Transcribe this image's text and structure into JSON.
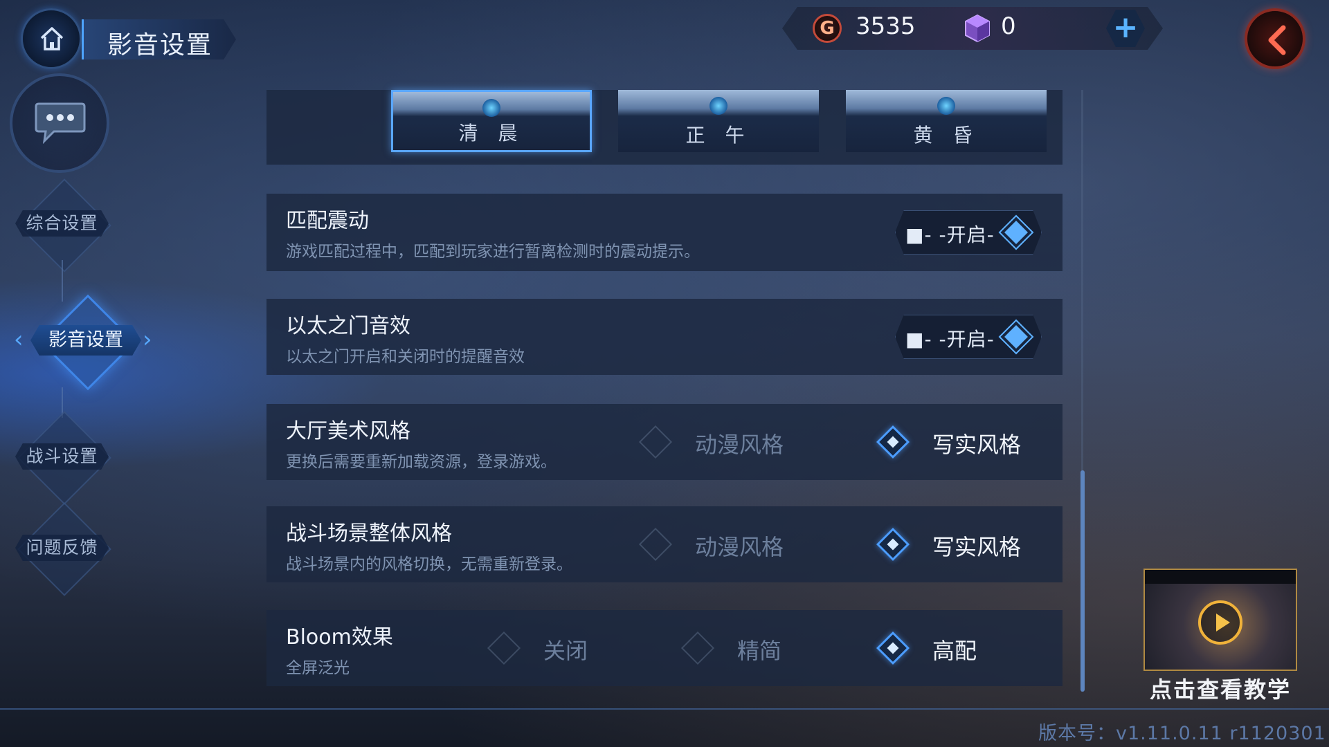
{
  "header": {
    "home_icon": "home-icon",
    "title": "影音设置"
  },
  "chat": {
    "icon": "chat-bubble-icon"
  },
  "sidebar": {
    "items": [
      {
        "label": "综合设置"
      },
      {
        "label": "影音设置"
      },
      {
        "label": "战斗设置"
      },
      {
        "label": "问题反馈"
      }
    ]
  },
  "currency": {
    "gold_symbol": "G",
    "gold_value": "3535",
    "gem_value": "0",
    "add_icon": "plus-icon"
  },
  "back": {
    "icon": "back-arrow-icon"
  },
  "time_of_day": {
    "options": [
      {
        "label": "清 晨"
      },
      {
        "label": "正 午"
      },
      {
        "label": "黄 昏"
      }
    ],
    "selected": 0
  },
  "settings": {
    "match_vibration": {
      "title": "匹配震动",
      "desc": "游戏匹配过程中，匹配到玩家进行暂离检测时的震动提示。",
      "toggle": "■- -开启-"
    },
    "ether_gate_sound": {
      "title": "以太之门音效",
      "desc": "以太之门开启和关闭时的提醒音效",
      "toggle": "■- -开启-"
    },
    "lobby_art_style": {
      "title": "大厅美术风格",
      "desc": "更换后需要重新加载资源，登录游戏。",
      "options": [
        "动漫风格",
        "写实风格"
      ],
      "selected": 1
    },
    "battle_scene_style": {
      "title": "战斗场景整体风格",
      "desc": "战斗场景内的风格切换，无需重新登录。",
      "options": [
        "动漫风格",
        "写实风格"
      ],
      "selected": 1
    },
    "bloom": {
      "title": "Bloom效果",
      "desc": "全屏泛光",
      "options": [
        "关闭",
        "精简",
        "高配"
      ],
      "selected": 2
    }
  },
  "tutorial": {
    "label": "点击查看教学",
    "icon": "play-icon"
  },
  "version": "版本号：v1.11.0.11 r1120301"
}
